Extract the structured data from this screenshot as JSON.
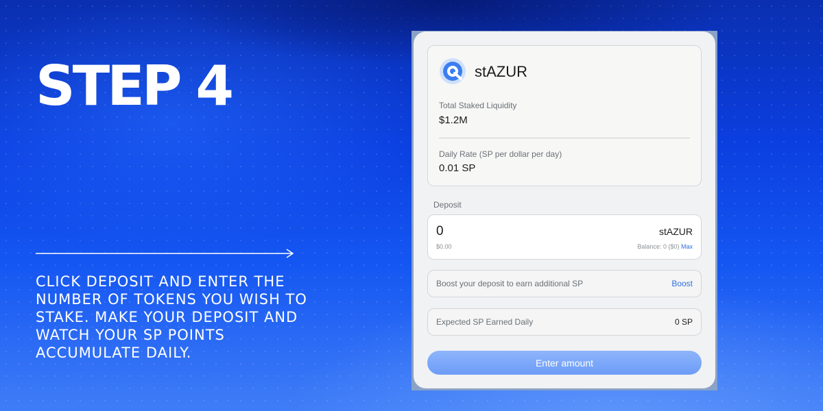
{
  "hero": {
    "title": "STEP 4",
    "description": "CLICK DEPOSIT AND ENTER THE NUMBER OF TOKENS YOU WISH TO STAKE. MAKE YOUR DEPOSIT AND WATCH YOUR SP POINTS ACCUMULATE DAILY."
  },
  "token": {
    "name": "stAZUR",
    "icon": "stazur-logo-icon"
  },
  "stats": {
    "total_label": "Total Staked Liquidity",
    "total_value": "$1.2M",
    "rate_label": "Daily Rate (SP per dollar per day)",
    "rate_value": "0.01 SP"
  },
  "deposit": {
    "label": "Deposit",
    "input_value": "0",
    "token": "stAZUR",
    "usd_value": "$0.00",
    "balance_text": "Balance: 0 ($0)",
    "max_label": "Max"
  },
  "boost": {
    "text": "Boost your deposit to earn additional SP",
    "link_label": "Boost"
  },
  "expected": {
    "label": "Expected SP Earned Daily",
    "value": "0 SP"
  },
  "cta": {
    "label": "Enter amount"
  },
  "colors": {
    "background": "#1557f2",
    "accent_link": "#2e6fe0",
    "button": "#7aa6f9",
    "panel": "#f1f2f4"
  }
}
